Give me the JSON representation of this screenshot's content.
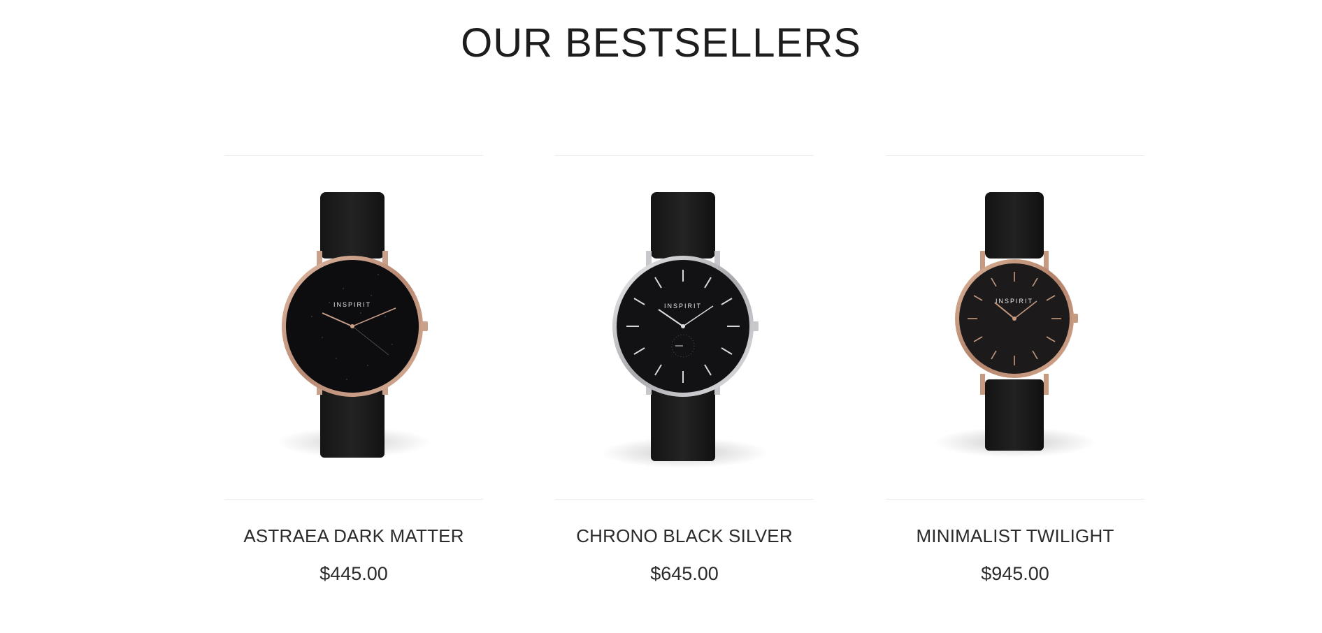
{
  "section": {
    "title": "OUR BESTSELLERS"
  },
  "products": [
    {
      "name": "ASTRAEA DARK MATTER",
      "price": "$445.00",
      "brand": "INSPIRIT",
      "image_icon": "watch-rose-gold-speckled-dial",
      "case_color": "#c9a08a",
      "dial_color": "#111114"
    },
    {
      "name": "CHRONO BLACK SILVER",
      "price": "$645.00",
      "brand": "INSPIRIT",
      "image_icon": "watch-silver-chrono-dial",
      "case_color": "#c8c8cc",
      "dial_color": "#121214"
    },
    {
      "name": "MINIMALIST TWILIGHT",
      "price": "$945.00",
      "brand": "INSPIRIT",
      "image_icon": "watch-rose-gold-minimal-dial",
      "case_color": "#c49a80",
      "dial_color": "#1c1a1b"
    }
  ]
}
